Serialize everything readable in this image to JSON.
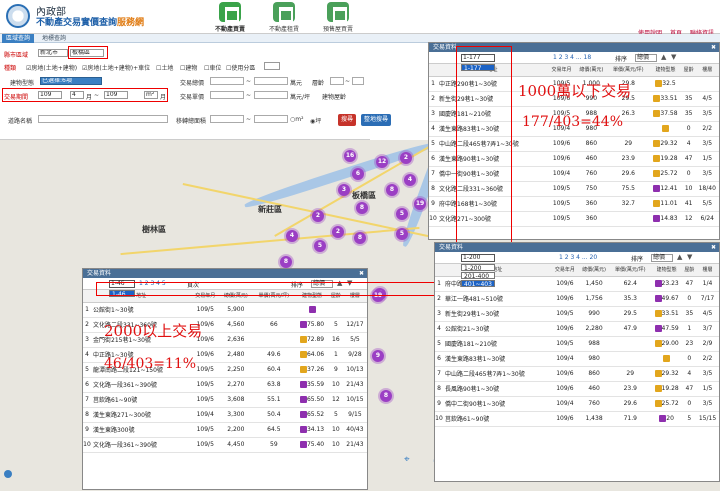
{
  "header": {
    "gov": "內政部",
    "title_main": "不動產交易實價查詢",
    "title_accent": "服務網",
    "nav": [
      "不動產買賣",
      "不動產租賃",
      "預售屋買賣"
    ],
    "links": [
      "使用說明",
      "首頁",
      "聯絡資訊"
    ]
  },
  "tabs": [
    "區域查詢",
    "地標查詢"
  ],
  "form": {
    "county_label": "縣市區域",
    "county": "新北市",
    "district": "板橋區",
    "type_label": "種類",
    "types": [
      "房地(土地+建物)",
      "房地(土地+建物)+車位",
      "土地",
      "建物",
      "車位",
      "使用分區"
    ],
    "building_label": "建物型態",
    "building": "已選擇:6項",
    "period_label": "交易期間",
    "y1": "109",
    "m1": "4",
    "y2": "109",
    "m2": "m²",
    "mo": "月",
    "dash": "~",
    "road_label": "道路名稱",
    "total_label": "交易總價",
    "unit_label": "交易單價",
    "wan": "萬元",
    "wanp": "萬元/坪",
    "floor_label": "層齡",
    "yr": "年",
    "age_label": "建物屋齡",
    "area_label": "移轉總面積",
    "ping": "坪",
    "search_btn": "搜尋",
    "advanced_btn": "整地搜尋"
  },
  "map": {
    "districts": [
      "新莊區",
      "板橋區",
      "樹林區"
    ],
    "clusters": [
      "16",
      "2",
      "12",
      "6",
      "3",
      "4",
      "8",
      "8",
      "5",
      "2",
      "19",
      "2",
      "4",
      "5",
      "8",
      "5",
      "8",
      "6",
      "2",
      "9",
      "12",
      "8",
      "15",
      "19"
    ]
  },
  "panels": {
    "title": "交易資料",
    "cols": [
      "地址",
      "交易年月",
      "總價(萬元)",
      "單價(萬元/坪)",
      "建物型態",
      "屋齡",
      "樓層"
    ],
    "perpage": "頁次",
    "sort": "排序",
    "sort_val": "總價",
    "p1": {
      "sel": "1-177",
      "opt": "1-177",
      "pages": "1 2 3 4 ... 18",
      "rows": [
        [
          "中正路290巷1~30號",
          "109/5",
          "1,000",
          "29.8",
          "32.5",
          "",
          ""
        ],
        [
          "新生街29巷1~30號",
          "109/6",
          "990",
          "29.5",
          "33.51",
          "35",
          "4/5"
        ],
        [
          "國慶路181~210號",
          "109/5",
          "988",
          "26.3",
          "37.58",
          "35",
          "3/5"
        ],
        [
          "漢生東路83巷1~30號",
          "109/4",
          "980",
          "",
          "",
          "0",
          "2/2"
        ],
        [
          "中山路二段465巷7弄1~30號",
          "109/6",
          "860",
          "29",
          "29.32",
          "4",
          "3/5"
        ],
        [
          "漢生東路90巷1~30號",
          "109/6",
          "460",
          "23.9",
          "19.28",
          "47",
          "1/5"
        ],
        [
          "僑中一街90巷1~30號",
          "109/4",
          "760",
          "29.6",
          "25.72",
          "0",
          "3/5"
        ],
        [
          "文化路二段331~360號",
          "109/5",
          "750",
          "75.5",
          "12.41",
          "10",
          "18/40"
        ],
        [
          "府中路168巷1~30號",
          "109/5",
          "360",
          "32.7",
          "11.01",
          "41",
          "5/5"
        ],
        [
          "文化路271~300號",
          "109/5",
          "360",
          "",
          "14.83",
          "12",
          "6/24"
        ]
      ],
      "tags": [
        "t1",
        "t1",
        "t1",
        "t1",
        "t1",
        "t1",
        "t1",
        "t2",
        "t1",
        "t2"
      ]
    },
    "p2": {
      "sel": "1-46",
      "opt": "1-46",
      "pages": "1 2 3 4 5",
      "rows": [
        [
          "公館街1~30號",
          "109/5",
          "5,900",
          "",
          "",
          "",
          ""
        ],
        [
          "文化路二段331~360號",
          "109/6",
          "4,560",
          "66",
          "75.80",
          "5",
          "12/17"
        ],
        [
          "金門街215巷1~30號",
          "109/6",
          "2,636",
          "",
          "72.89",
          "16",
          "5/5"
        ],
        [
          "中正路1~30號",
          "109/6",
          "2,480",
          "49.6",
          "64.06",
          "1",
          "9/28"
        ],
        [
          "龍潭南路二段121~150號",
          "109/5",
          "2,250",
          "60.4",
          "37.26",
          "9",
          "10/13"
        ],
        [
          "文化路一段361~390號",
          "109/5",
          "2,270",
          "63.8",
          "35.59",
          "10",
          "21/43"
        ],
        [
          "莒欽路61~90號",
          "109/5",
          "3,608",
          "55.1",
          "65.50",
          "12",
          "10/15"
        ],
        [
          "漢生東路271~300號",
          "109/4",
          "3,300",
          "50.4",
          "65.52",
          "5",
          "9/15"
        ],
        [
          "漢生東路300號",
          "109/5",
          "2,200",
          "64.5",
          "34.13",
          "10",
          "40/43"
        ],
        [
          "文化路一段361~390號",
          "109/5",
          "4,450",
          "59",
          "75.40",
          "10",
          "21/43"
        ]
      ],
      "tags": [
        "t2",
        "t2",
        "t1",
        "t1",
        "t1",
        "t2",
        "t2",
        "t2",
        "t2",
        "t2"
      ]
    },
    "p3": {
      "sel": "1-200",
      "opts": [
        "1-200",
        "201-400",
        "401~403"
      ],
      "pages": "1 2 3 4 ... 20",
      "rows": [
        [
          "府中路1~30號",
          "109/6",
          "1,450",
          "62.4",
          "23.23",
          "47",
          "1/4"
        ],
        [
          "華江一路481~510號",
          "109/6",
          "1,756",
          "35.3",
          "49.67",
          "0",
          "7/17"
        ],
        [
          "新生街29巷1~30號",
          "109/5",
          "990",
          "29.5",
          "33.51",
          "35",
          "4/5"
        ],
        [
          "公館街21~30號",
          "109/6",
          "2,280",
          "47.9",
          "47.59",
          "1",
          "3/7"
        ],
        [
          "國慶路181~210號",
          "109/5",
          "988",
          "",
          "29.00",
          "23",
          "2/9"
        ],
        [
          "漢生東路83巷1~30號",
          "109/4",
          "980",
          "",
          "",
          "0",
          "2/2"
        ],
        [
          "中山路二段465巷7弄1~30號",
          "109/6",
          "860",
          "29",
          "29.32",
          "4",
          "3/5"
        ],
        [
          "長風路90巷1~30號",
          "109/6",
          "460",
          "23.9",
          "19.28",
          "47",
          "1/5"
        ],
        [
          "僑中二街90巷1~30號",
          "109/4",
          "760",
          "29.6",
          "25.72",
          "0",
          "3/5"
        ],
        [
          "莒欽路61~90號",
          "109/6",
          "1,438",
          "71.9",
          "20",
          "5",
          "15/15"
        ]
      ],
      "tags": [
        "t2",
        "t2",
        "t1",
        "t2",
        "t1",
        "t1",
        "t1",
        "t1",
        "t1",
        "t2"
      ]
    }
  },
  "annotations": {
    "a1": "1000萬以下交易",
    "a2": "177/403=44%",
    "a3": "2000以上交易",
    "a4": "46/403=11%"
  },
  "colors": {
    "accent": "#3a7fc2",
    "annot": "#e01010",
    "cluster": "#9b3fc4"
  }
}
